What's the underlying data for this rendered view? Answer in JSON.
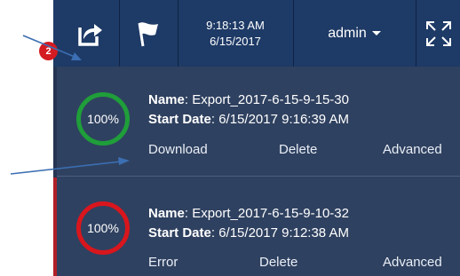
{
  "topbar": {
    "clock_time": "9:18:13 AM",
    "clock_date": "6/15/2017",
    "user": "admin",
    "export_badge": "2",
    "icons": [
      "export-icon",
      "flag-icon",
      "caret-down-icon",
      "expand-icon"
    ]
  },
  "exports": [
    {
      "progress": "100%",
      "status_color": "#1f9e3a",
      "name_label": "Name",
      "name": "Export_2017-6-15-9-15-30",
      "start_label": "Start Date",
      "start_date": "6/15/2017 9:16:39 AM",
      "actions": [
        "Download",
        "Delete",
        "Advanced"
      ]
    },
    {
      "progress": "100%",
      "status_color": "#d9161d",
      "name_label": "Name",
      "name": "Export_2017-6-15-9-10-32",
      "start_label": "Start Date",
      "start_date": "6/15/2017 9:12:38 AM",
      "actions": [
        "Error",
        "Delete",
        "Advanced"
      ]
    }
  ],
  "colors": {
    "topbar": "#1e3a66",
    "panel": "#2f4160",
    "badge": "#d41b22",
    "arrow": "#3b6eb2"
  }
}
